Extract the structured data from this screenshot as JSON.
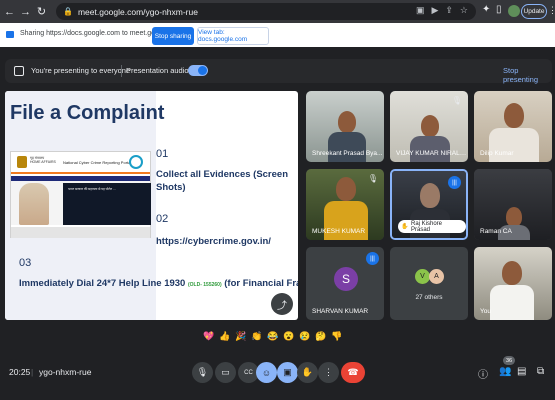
{
  "browser": {
    "url": "meet.google.com/ygo-nhxm-rue",
    "update_label": "Update"
  },
  "sharing_bar": {
    "message": "Sharing https://docs.google.com to meet.google.com",
    "stop_label": "Stop sharing",
    "view_tab_label": "View tab: docs.google.com"
  },
  "presenting_bar": {
    "message": "You're presenting to everyone",
    "audio_label": "Presentation audio",
    "stop_label": "Stop presenting"
  },
  "slide": {
    "title": "File a Complaint",
    "screenshot": {
      "ministry": "गृह मंत्रालय\nHOME AFFAIRS",
      "portal_name": "National Cyber Crime Reporting Portal",
      "hindi_text": "भारत सरकार की सहायता से यह पोर्टल ..."
    },
    "items": [
      {
        "num": "01",
        "text": "Collect all Evidences (Screen Shots)"
      },
      {
        "num": "02",
        "text": "https://cybercrime.gov.in/"
      },
      {
        "num": "03",
        "text_main": "Immediately Dial 24*7 Help Line 1930",
        "text_old": "(OLD- 155260)",
        "text_tail": "(for Financial Fraud)"
      }
    ]
  },
  "participants": [
    {
      "name": "Shreekant Prasad Bya...",
      "muted": false
    },
    {
      "name": "VIJAY KUMAR NIRALA...",
      "muted": true
    },
    {
      "name": "Dilip Kumar",
      "muted": false
    },
    {
      "name": "MUKESH KUMAR",
      "muted": true
    },
    {
      "name": "Raj Kishore Prasad",
      "speaking": true
    },
    {
      "name": "Raman CA",
      "muted": false
    },
    {
      "name": "SHARVAN KUMAR",
      "initial": "S",
      "speaking": true
    },
    {
      "others_label": "27 others",
      "initials": [
        "V",
        "A"
      ]
    },
    {
      "name": "You"
    }
  ],
  "reactions": [
    "💖",
    "👍",
    "🎉",
    "👏",
    "😂",
    "😮",
    "😢",
    "🤔",
    "👎"
  ],
  "bottom_bar": {
    "time": "20:25",
    "meeting_code": "ygo-nhxm-rue",
    "participant_count": "36"
  },
  "colors": {
    "accent": "#1a73e8",
    "end_call": "#ea4335",
    "slide_title": "#1f3864"
  }
}
